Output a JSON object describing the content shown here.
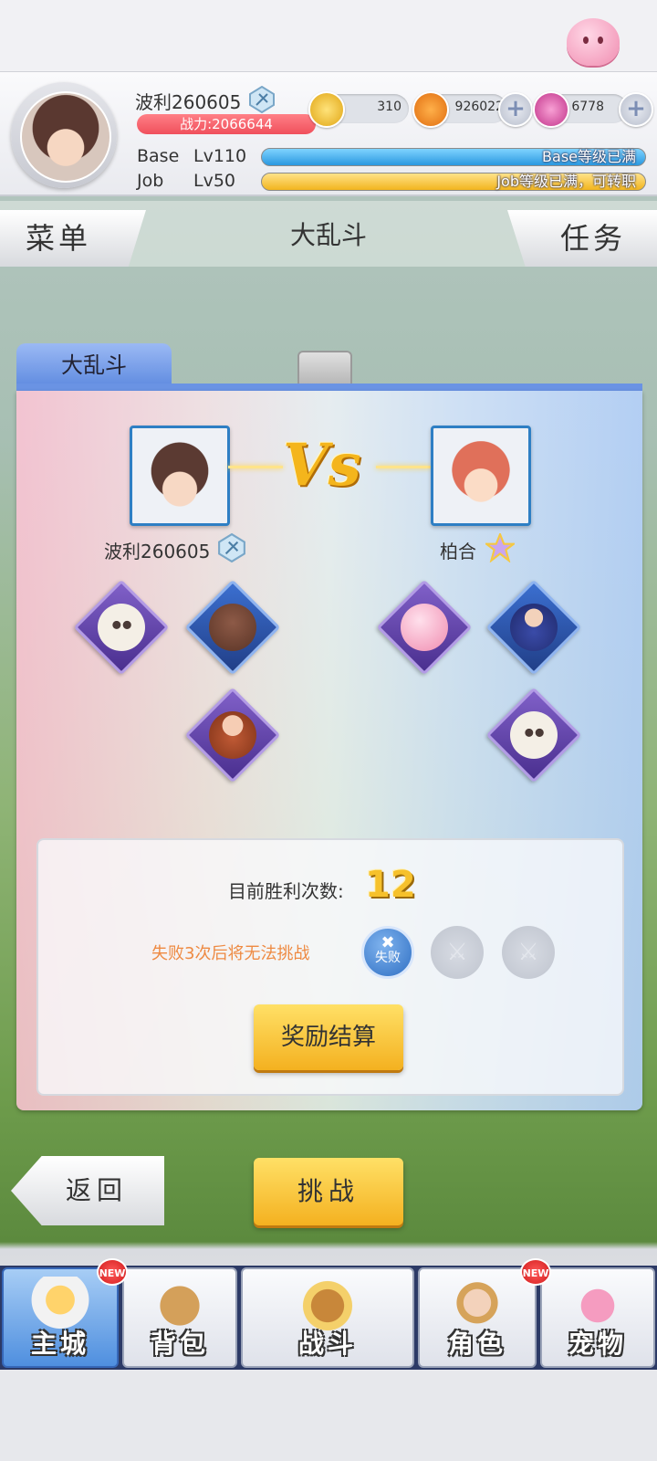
{
  "player": {
    "name": "波利260605",
    "power": "战力:2066644",
    "base_label": "Base",
    "base_level": "Lv110",
    "base_status": "Base等级已满",
    "job_label": "Job",
    "job_level": "Lv50",
    "job_status": "Job等级已满，可转职"
  },
  "currencies": [
    {
      "icon": "zeny-coin-icon",
      "value": "310",
      "color": "#f6c12c"
    },
    {
      "icon": "gold-coin-icon",
      "value": "926022",
      "color": "#f39a22"
    },
    {
      "icon": "pink-gem-icon",
      "value": "6778",
      "color": "#d84aa0"
    }
  ],
  "nav": {
    "menu": "菜单",
    "title": "大乱斗",
    "task": "任务"
  },
  "battle": {
    "tab": "大乱斗",
    "left_fighter": "波利260605",
    "right_fighter": "柏合",
    "vs": "Vs",
    "wins_label": "目前胜利次数:",
    "wins_value": "12",
    "fail_note": "失败3次后将无法挑战",
    "lost_label": "失败",
    "reward_button": "奖励结算"
  },
  "actions": {
    "back": "返回",
    "challenge": "挑战"
  },
  "tabbar": [
    {
      "label": "主城",
      "icon": "castle-icon",
      "new": true
    },
    {
      "label": "背包",
      "icon": "backpack-icon",
      "new": false
    },
    {
      "label": "战斗",
      "icon": "battle-shield-icon",
      "new": false
    },
    {
      "label": "角色",
      "icon": "character-icon",
      "new": true
    },
    {
      "label": "宠物",
      "icon": "pet-poring-icon",
      "new": false
    }
  ],
  "new_badge": "NEW"
}
